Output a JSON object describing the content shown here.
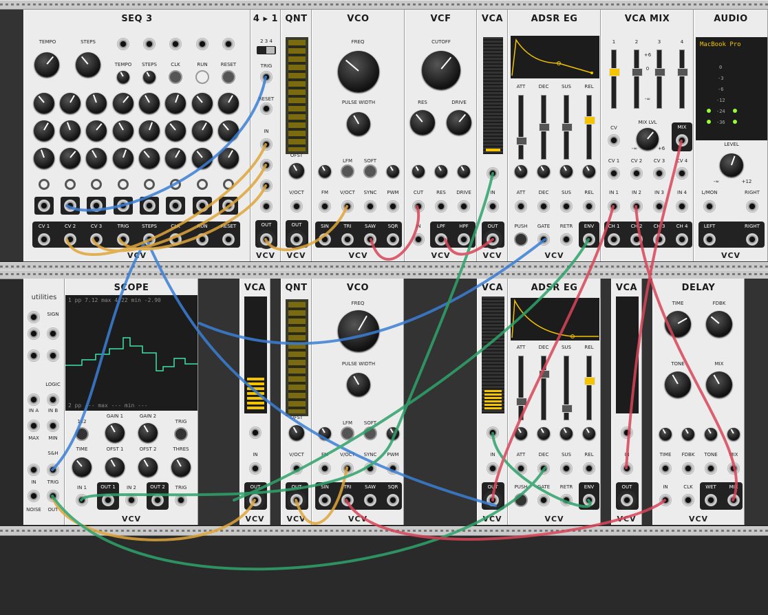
{
  "modules": {
    "seq3": {
      "title": "SEQ 3",
      "brand": "VCV",
      "tempo": "TEMPO",
      "steps": "STEPS",
      "tempo_small": "TEMPO",
      "steps_small": "STEPS",
      "clk": "CLK",
      "run": "RUN",
      "reset": "RESET",
      "outs": [
        "CV 1",
        "CV 2",
        "CV 3",
        "TRIG",
        "STEPS",
        "CLK",
        "RUN",
        "RESET"
      ]
    },
    "switch41": {
      "title": "4 ▸ 1",
      "brand": "VCV",
      "positions": "2 3 4",
      "trig": "TRIG",
      "reset": "RESET",
      "in": "IN",
      "out": "OUT"
    },
    "qnt1": {
      "title": "QNT",
      "brand": "VCV",
      "ofst": "OFST",
      "voct": "V/OCT",
      "out": "OUT"
    },
    "vco1": {
      "title": "VCO",
      "brand": "VCV",
      "freq": "FREQ",
      "pulse_width": "PULSE WIDTH",
      "lfm": "LFM",
      "soft": "SOFT",
      "fm": "FM",
      "voct": "V/OCT",
      "sync": "SYNC",
      "pwm": "PWM",
      "outs": [
        "SIN",
        "TRI",
        "SAW",
        "SQR"
      ]
    },
    "vcf": {
      "title": "VCF",
      "brand": "VCV",
      "cutoff": "CUTOFF",
      "res": "RES",
      "drive": "DRIVE",
      "cut": "CUT",
      "res2": "RES",
      "drive2": "DRIVE",
      "in": "IN",
      "lpf": "LPF",
      "hpf": "HPF"
    },
    "vca1": {
      "title": "VCA",
      "brand": "VCV",
      "in": "IN",
      "out": "OUT"
    },
    "adsr1": {
      "title": "ADSR EG",
      "brand": "VCV",
      "att": "ATT",
      "dec": "DEC",
      "sus": "SUS",
      "rel": "REL",
      "push": "PUSH",
      "gate": "GATE",
      "retr": "RETR",
      "env": "ENV"
    },
    "vcamix": {
      "title": "VCA MIX",
      "brand": "VCV",
      "channels": [
        "1",
        "2",
        "3",
        "4"
      ],
      "scale": [
        "+6",
        "0",
        "-∞"
      ],
      "cv": "CV",
      "mix_lvl": "MIX LVL",
      "mix": "MIX",
      "min": "-∞",
      "max": "+6",
      "cv_ins": [
        "CV 1",
        "CV 2",
        "CV 3",
        "CV 4"
      ],
      "ins": [
        "IN 1",
        "IN 2",
        "IN 3",
        "IN 4"
      ],
      "outs": [
        "CH 1",
        "CH 2",
        "CH 3",
        "CH 4"
      ]
    },
    "audio": {
      "title": "AUDIO",
      "brand": "VCV",
      "device": "MacBook Pro",
      "db": [
        "0",
        "-3",
        "-6",
        "-12",
        "-24",
        "-36"
      ],
      "level": "LEVEL",
      "min": "-∞",
      "max": "+12",
      "lmon": "L/MON",
      "right": "RIGHT",
      "left": "LEFT",
      "right_out": "RIGHT"
    },
    "utilities": {
      "title": "utilities",
      "sign": "SIGN",
      "logic": "LOGIC",
      "ina": "IN A",
      "inb": "IN B",
      "max": "MAX",
      "min": "MIN",
      "sh": "S&H",
      "in": "IN",
      "trig": "TRIG",
      "noise": "NOISE",
      "out": "OUT"
    },
    "scope": {
      "title": "SCOPE",
      "brand": "VCV",
      "readout1": "1 pp   7.12 max  4.22 min -2.90",
      "readout2": "2 pp  ---  max  ---  min  ---",
      "x12": "1x2",
      "gain1": "GAIN 1",
      "gain2": "GAIN 2",
      "trig": "TRIG",
      "time": "TIME",
      "ofst1": "OFST 1",
      "ofst2": "OFST 2",
      "thres": "THRES",
      "in1": "IN 1",
      "out1": "OUT 1",
      "in2": "IN 2",
      "out2": "OUT 2",
      "trig2": "TRIG"
    },
    "vca2": {
      "title": "VCA",
      "brand": "VCV",
      "in": "IN",
      "out": "OUT"
    },
    "qnt2": {
      "title": "QNT",
      "brand": "VCV",
      "ofst": "OFST",
      "voct": "V/OCT",
      "out": "OUT"
    },
    "vco2": {
      "title": "VCO",
      "brand": "VCV",
      "freq": "FREQ",
      "pulse_width": "PULSE WIDTH",
      "lfm": "LFM",
      "soft": "SOFT",
      "fm": "FM",
      "voct": "V/OCT",
      "sync": "SYNC",
      "pwm": "PWM",
      "outs": [
        "SIN",
        "TRI",
        "SAW",
        "SQR"
      ]
    },
    "vca3": {
      "title": "VCA",
      "brand": "VCV",
      "in": "IN",
      "out": "OUT"
    },
    "adsr2": {
      "title": "ADSR EG",
      "brand": "VCV",
      "att": "ATT",
      "dec": "DEC",
      "sus": "SUS",
      "rel": "REL",
      "push": "PUSH",
      "gate": "GATE",
      "retr": "RETR",
      "env": "ENV"
    },
    "vca4": {
      "title": "VCA",
      "brand": "VCV",
      "in": "IN",
      "out": "OUT"
    },
    "delay": {
      "title": "DELAY",
      "brand": "VCV",
      "time": "TIME",
      "fdbk": "FDBK",
      "tone": "TONE",
      "mix": "MIX",
      "time2": "TIME",
      "fdbk2": "FDBK",
      "tone2": "TONE",
      "mix2": "MIX",
      "in": "IN",
      "clk": "CLK",
      "wet": "WET",
      "mix_out": "MIX"
    }
  },
  "colors": {
    "cable_blue": "#3a7fd5",
    "cable_yellow": "#e0a63a",
    "cable_green": "#2fa36b",
    "cable_red": "#d9465a",
    "panel": "#ececec",
    "rail": "#c9c9c9",
    "accent_yellow": "#f5c400"
  }
}
